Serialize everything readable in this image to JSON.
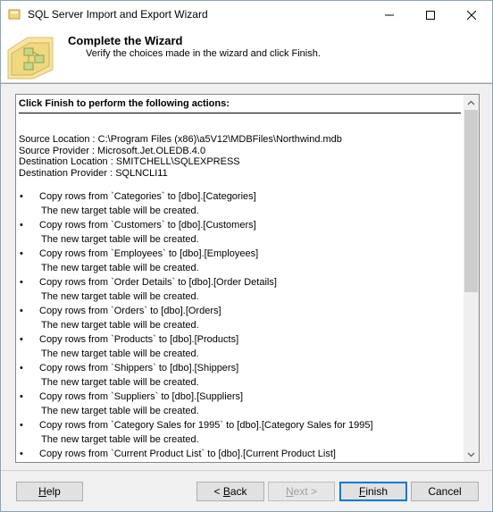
{
  "window": {
    "title": "SQL Server Import and Export Wizard",
    "controls": {
      "minimize": "minimize-icon",
      "maximize": "maximize-icon",
      "close": "close-icon"
    }
  },
  "header": {
    "title": "Complete the Wizard",
    "subtitle": "Verify the choices made in the wizard and click Finish."
  },
  "summary": {
    "heading": "Click Finish to perform the following actions:",
    "info": [
      "Source Location : C:\\Program Files (x86)\\a5V12\\MDBFiles\\Northwind.mdb",
      "Source Provider : Microsoft.Jet.OLEDB.4.0",
      "Destination Location : SMITCHELL\\SQLEXPRESS",
      "Destination Provider : SQLNCLI11"
    ],
    "bullet": "•",
    "actions": [
      {
        "action": "Copy rows from `Categories` to [dbo].[Categories]",
        "note": "The new target table will be created."
      },
      {
        "action": "Copy rows from `Customers` to [dbo].[Customers]",
        "note": "The new target table will be created."
      },
      {
        "action": "Copy rows from `Employees` to [dbo].[Employees]",
        "note": "The new target table will be created."
      },
      {
        "action": "Copy rows from `Order Details` to [dbo].[Order Details]",
        "note": "The new target table will be created."
      },
      {
        "action": "Copy rows from `Orders` to [dbo].[Orders]",
        "note": "The new target table will be created."
      },
      {
        "action": "Copy rows from `Products` to [dbo].[Products]",
        "note": "The new target table will be created."
      },
      {
        "action": "Copy rows from `Shippers` to [dbo].[Shippers]",
        "note": "The new target table will be created."
      },
      {
        "action": "Copy rows from `Suppliers` to [dbo].[Suppliers]",
        "note": "The new target table will be created."
      },
      {
        "action": "Copy rows from `Category Sales for 1995` to [dbo].[Category Sales for 1995]",
        "note": "The new target table will be created."
      },
      {
        "action": "Copy rows from `Current Product List` to [dbo].[Current Product List]",
        "note": ""
      }
    ]
  },
  "buttons": {
    "help": {
      "mnemonic": "H",
      "rest": "elp"
    },
    "back": {
      "prefix": "< ",
      "mnemonic": "B",
      "rest": "ack"
    },
    "next": {
      "prefix": "",
      "mnemonic": "N",
      "rest": "ext >",
      "enabled": false
    },
    "finish": {
      "mnemonic": "F",
      "rest": "inish"
    },
    "cancel": {
      "label": "Cancel"
    }
  },
  "colors": {
    "focus_border": "#0078d7",
    "disabled_text": "#a0a0a0"
  }
}
